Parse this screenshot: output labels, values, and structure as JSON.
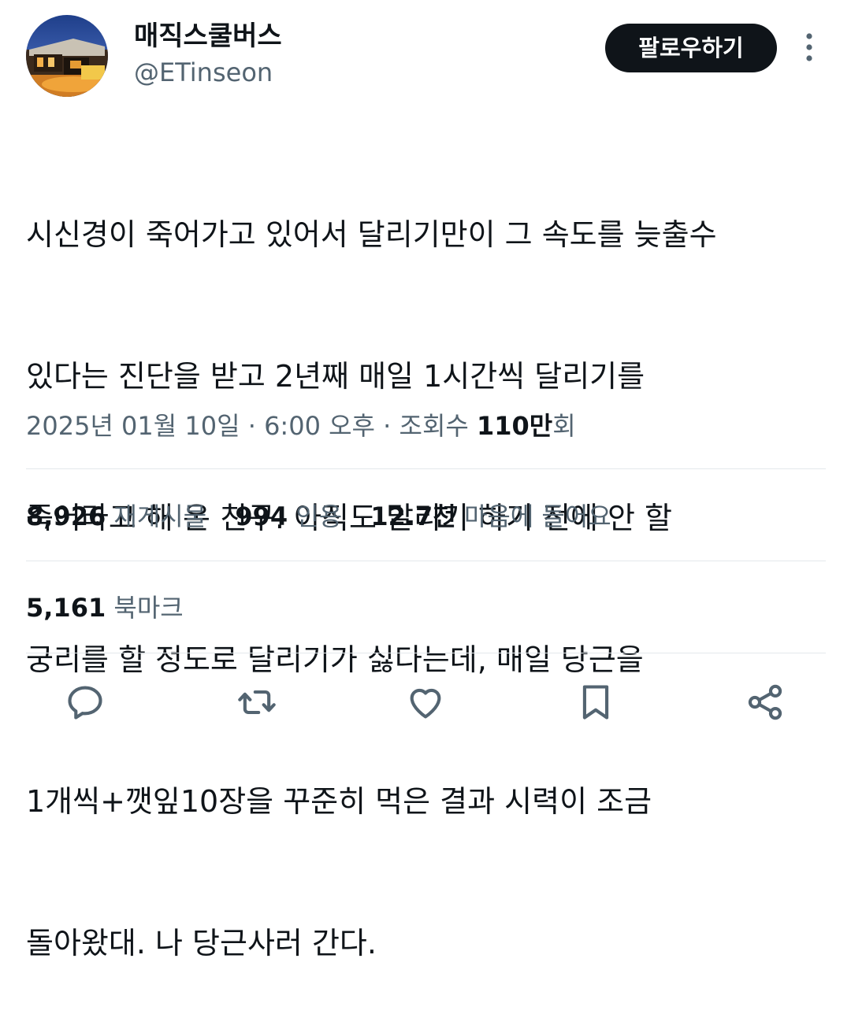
{
  "author": {
    "display_name": "매직스쿨버스",
    "handle": "@ETinseon"
  },
  "follow_button": {
    "label": "팔로우하기"
  },
  "tweet": {
    "lines": [
      "시신경이 죽어가고 있어서 달리기만이 그 속도를 늦출수",
      "있다는 진단을 받고 2년째 매일 1시간씩 달리기를",
      "죽어라고 해 온 친구. 아직도 달리기 하기 전에 안 할",
      "궁리를 할 정도로 달리기가 싫다는데, 매일 당근을",
      "1개씩+깻잎10장을 꾸준히 먹은 결과 시력이 조금",
      "돌아왔대. 나 당근사러 간다."
    ]
  },
  "meta": {
    "date": "2025년 01월 10일",
    "separator": " · ",
    "time": "6:00 오후",
    "views_label": "조회수",
    "views_count": "110만",
    "views_suffix": "회"
  },
  "stats": {
    "reposts": {
      "count": "8,926",
      "label": "재게시물"
    },
    "quotes": {
      "count": "994",
      "label": "인용"
    },
    "likes": {
      "count": "12.7천",
      "label": "마음에 들어요"
    },
    "bookmarks": {
      "count": "5,161",
      "label": "북마크"
    }
  },
  "actions": {
    "icons": [
      "reply-icon",
      "repost-icon",
      "like-icon",
      "bookmark-icon",
      "share-icon"
    ]
  },
  "colors": {
    "text": "#0f1419",
    "secondary": "#536471",
    "divider": "#e3e8ec",
    "button_bg": "#0f1419",
    "button_text": "#ffffff"
  }
}
